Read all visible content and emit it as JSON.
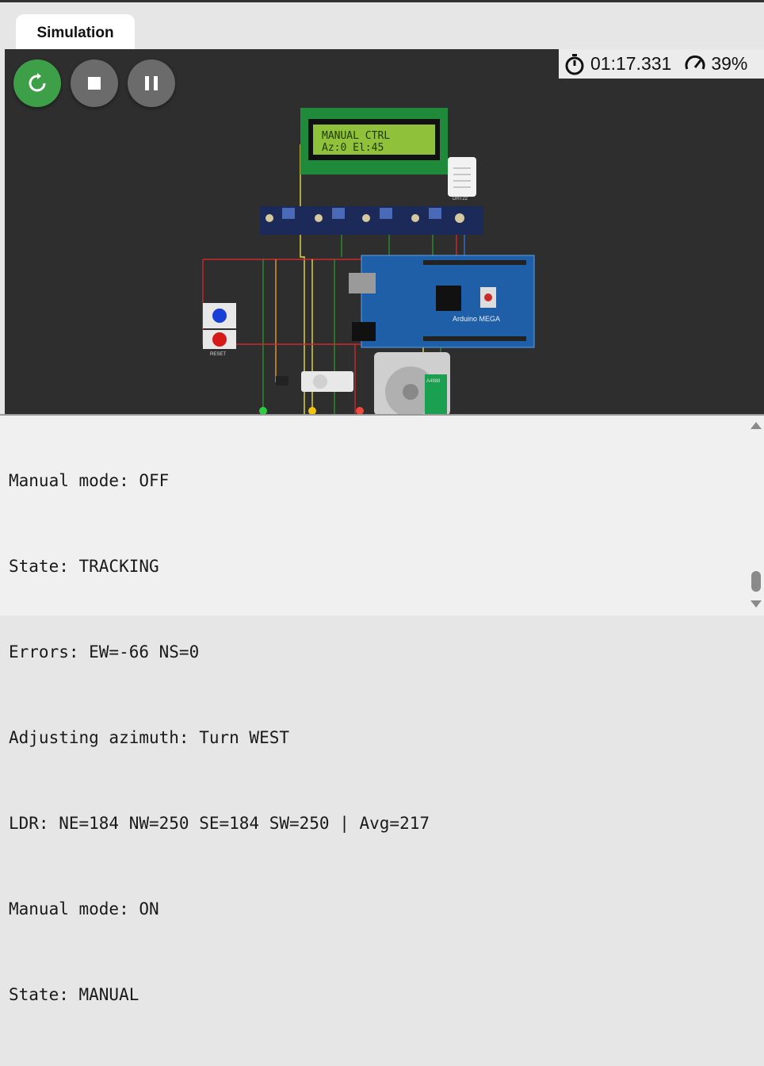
{
  "tab": {
    "label": "Simulation"
  },
  "controls": {
    "restart_icon": "restart-icon",
    "stop_icon": "stop-icon",
    "pause_icon": "pause-icon",
    "restart_color": "#3d9f47",
    "button_color": "#6b6b6b"
  },
  "status": {
    "timer": "01:17.331",
    "speed": "39%",
    "timer_icon": "stopwatch-icon",
    "speed_icon": "speedometer-icon"
  },
  "circuit": {
    "lcd_line1": "MANUAL CTRL",
    "lcd_line2": "Az:0 El:45",
    "dht_label": "DHT22",
    "arduino_label": "Arduino MEGA",
    "reset_label": "RESET",
    "driver_label": "A4988"
  },
  "serial": {
    "lines": [
      "Manual mode: OFF",
      "State: TRACKING",
      "Errors: EW=-66 NS=0",
      "Adjusting azimuth: Turn WEST",
      "LDR: NE=184 NW=250 SE=184 SW=250 | Avg=217",
      "Manual mode: ON",
      "State: MANUAL"
    ]
  }
}
